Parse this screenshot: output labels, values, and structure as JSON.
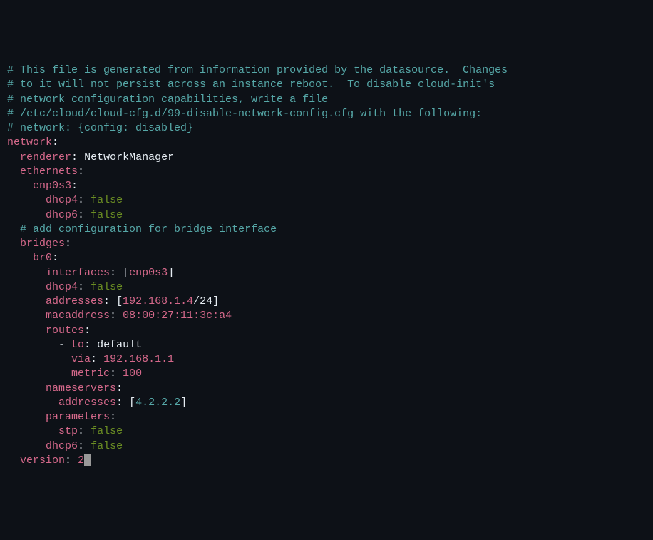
{
  "comments": {
    "c1": "# This file is generated from information provided by the datasource.  Changes",
    "c2": "# to it will not persist across an instance reboot.  To disable cloud-init's",
    "c3": "# network configuration capabilities, write a file",
    "c4": "# /etc/cloud/cloud-cfg.d/99-disable-network-config.cfg with the following:",
    "c5": "# network: {config: disabled}",
    "c6": "# add configuration for bridge interface"
  },
  "keys": {
    "network": "network",
    "renderer": "renderer",
    "ethernets": "ethernets",
    "enp0s3": "enp0s3",
    "dhcp4": "dhcp4",
    "dhcp6": "dhcp6",
    "bridges": "bridges",
    "br0": "br0",
    "interfaces": "interfaces",
    "addresses": "addresses",
    "macaddress": "macaddress",
    "routes": "routes",
    "to": "to",
    "via": "via",
    "metric": "metric",
    "nameservers": "nameservers",
    "parameters": "parameters",
    "stp": "stp",
    "version": "version"
  },
  "values": {
    "renderer": "NetworkManager",
    "false": "false",
    "interface_item": "enp0s3",
    "address_ip": "192.168.1.4",
    "address_cidr": "/24",
    "mac": "08:00:27:11:3c:a4",
    "route_to": "default",
    "route_via": "192.168.1.1",
    "route_metric": "100",
    "nameserver": "4.2.2.2",
    "version": "2"
  },
  "symbols": {
    "colon": ":",
    "lbracket": "[",
    "rbracket": "]",
    "dash_to": "- ",
    "space": " "
  }
}
